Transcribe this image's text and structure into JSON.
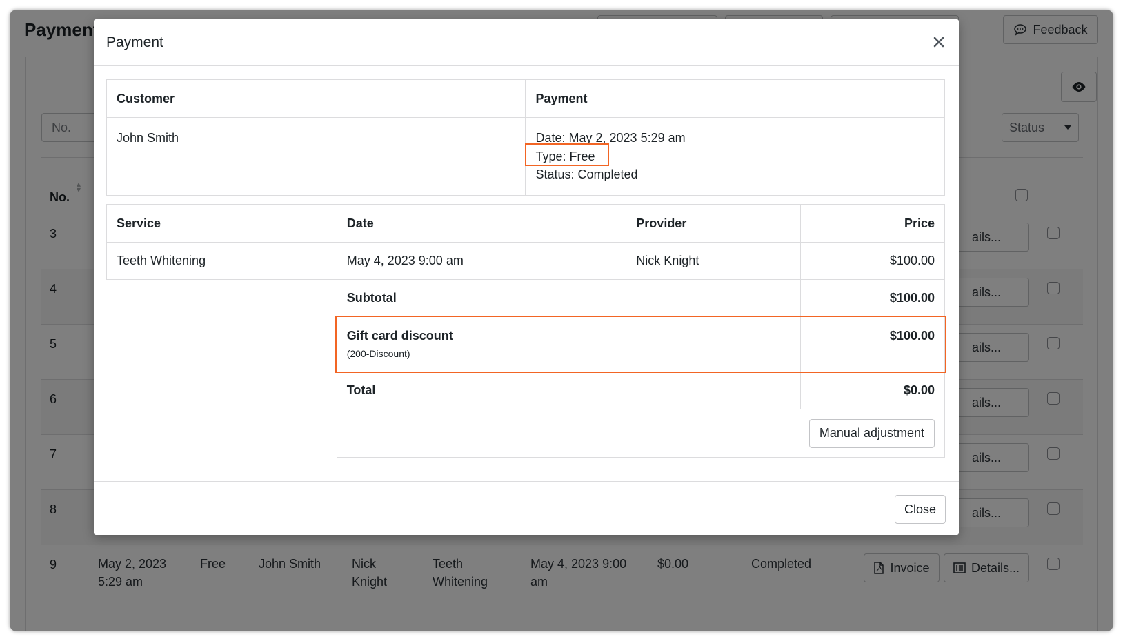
{
  "page": {
    "title": "Payment",
    "feedback_label": "Feedback"
  },
  "filters": {
    "no_placeholder": "No.",
    "status_label": "Status"
  },
  "list": {
    "col_no": "No.",
    "rows": [
      {
        "no": "3",
        "details_label": "ails..."
      },
      {
        "no": "4",
        "details_label": "ails..."
      },
      {
        "no": "5",
        "details_label": "ails..."
      },
      {
        "no": "6",
        "details_label": "ails..."
      },
      {
        "no": "7",
        "details_label": "ails..."
      },
      {
        "no": "8",
        "details_label": "ails..."
      }
    ],
    "last_row": {
      "no": "9",
      "date_line1": "May 2, 2023",
      "date_line2": "5:29 am",
      "type": "Free",
      "customer": "John Smith",
      "provider_line1": "Nick",
      "provider_line2": "Knight",
      "service_line1": "Teeth",
      "service_line2": "Whitening",
      "appt_line1": "May 4, 2023 9:00",
      "appt_line2": "am",
      "total": "$0.00",
      "status": "Completed",
      "invoice_label": "Invoice",
      "details_label": "Details..."
    }
  },
  "modal": {
    "title": "Payment",
    "customer_header": "Customer",
    "payment_header": "Payment",
    "customer_name": "John Smith",
    "payment_date": "Date: May 2, 2023 5:29 am",
    "payment_type": "Type: Free",
    "payment_status": "Status: Completed",
    "service_table": {
      "headers": {
        "service": "Service",
        "date": "Date",
        "provider": "Provider",
        "price": "Price"
      },
      "item": {
        "service": "Teeth Whitening",
        "date": "May 4, 2023 9:00 am",
        "provider": "Nick Knight",
        "price": "$100.00"
      },
      "subtotal_label": "Subtotal",
      "subtotal_value": "$100.00",
      "discount_label": "Gift card discount",
      "discount_code": "(200-Discount)",
      "discount_value": "$100.00",
      "total_label": "Total",
      "total_value": "$0.00",
      "adjust_label": "Manual adjustment"
    },
    "close_label": "Close"
  },
  "colors": {
    "highlight": "#f26524",
    "overlay": "rgba(0,0,0,0.5)"
  }
}
